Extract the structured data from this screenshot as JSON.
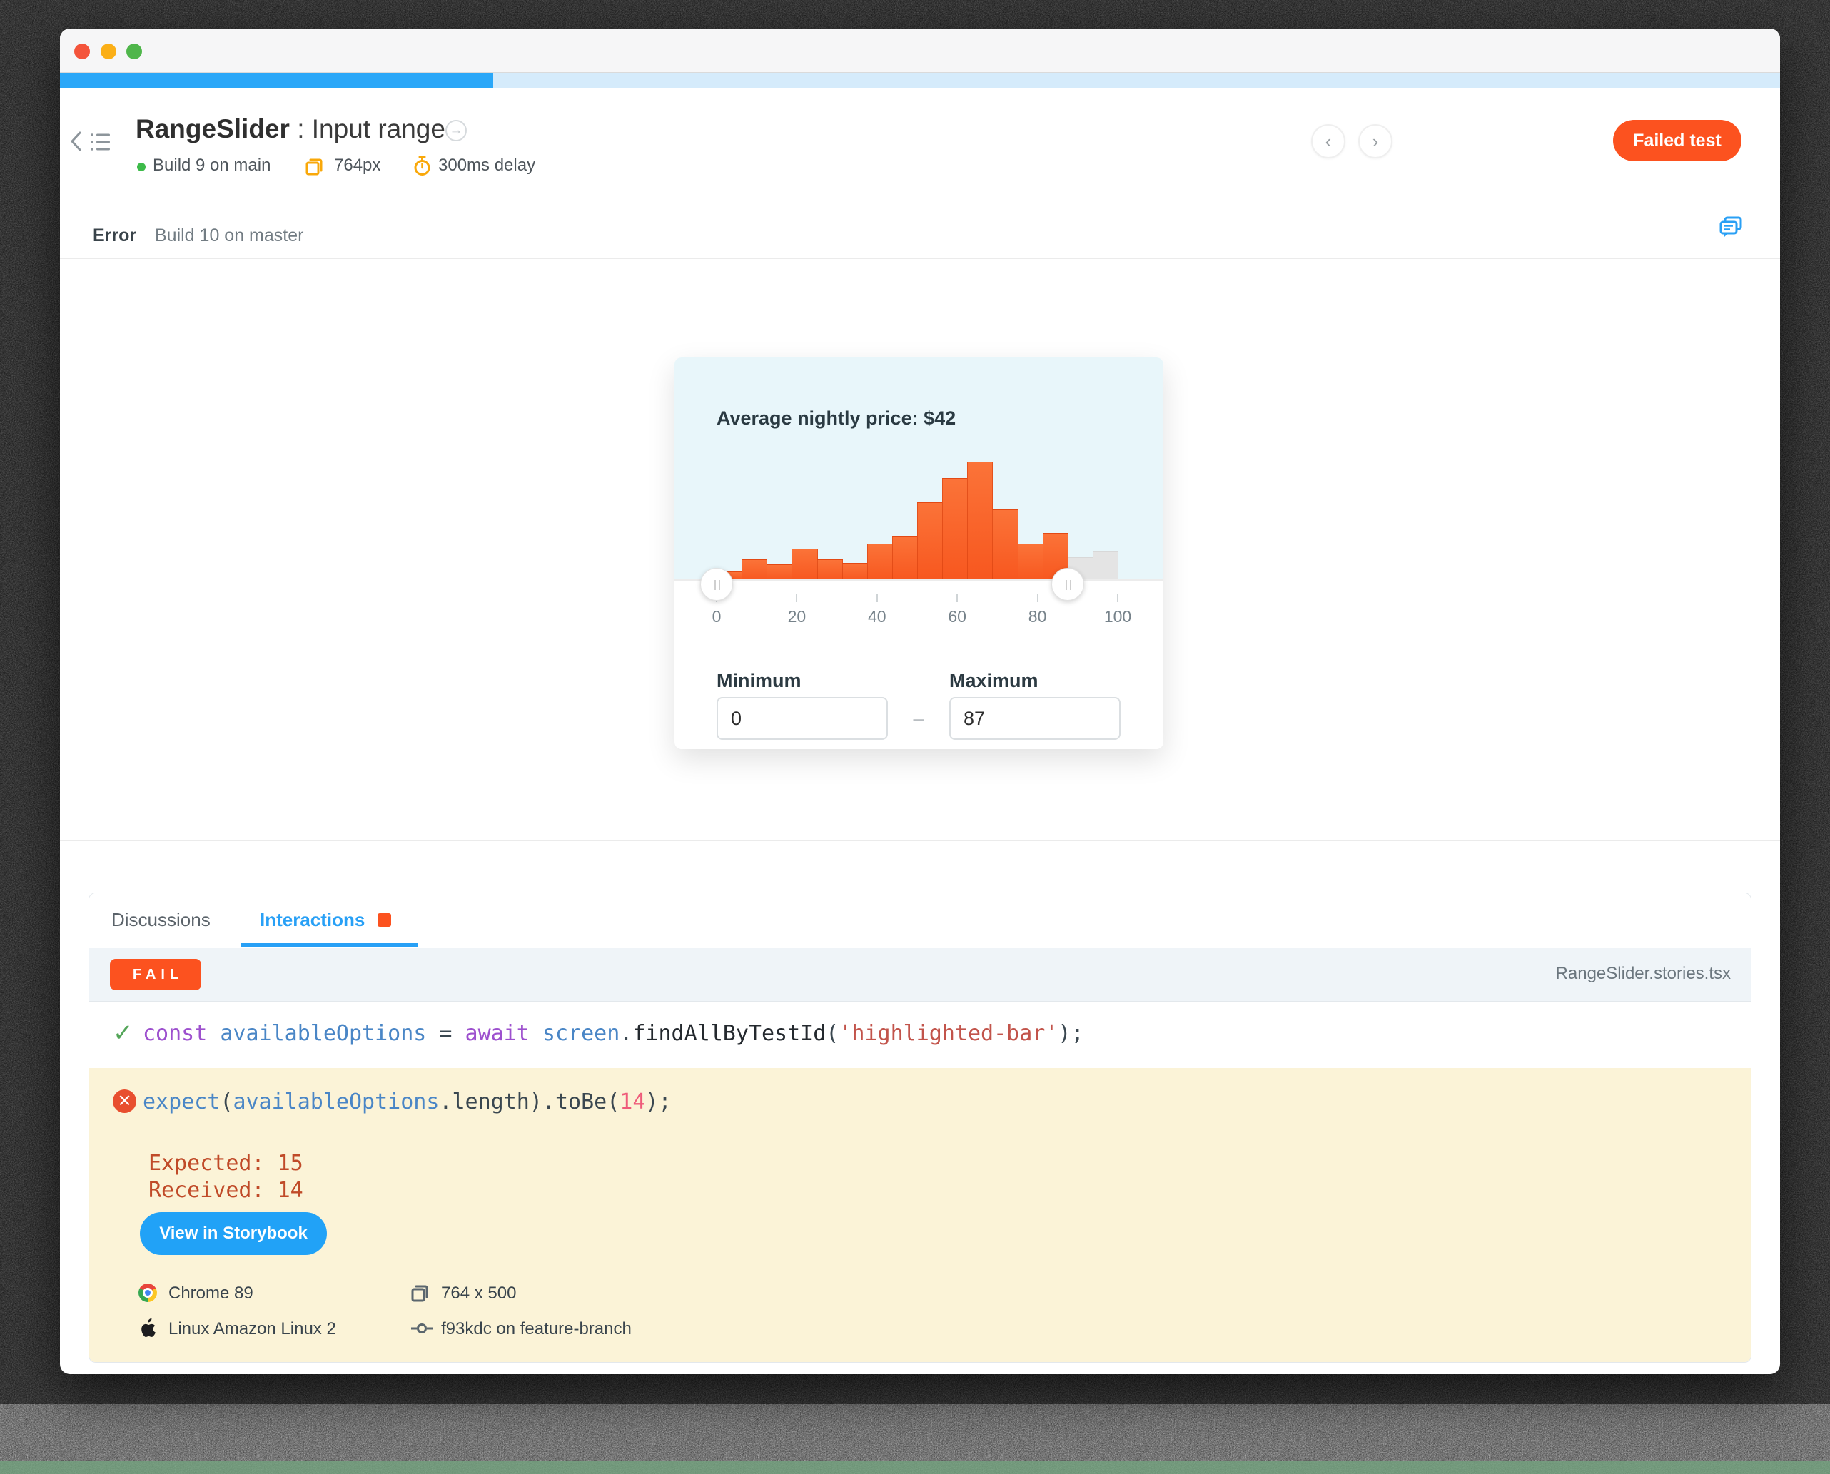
{
  "header": {
    "title_component": "RangeSlider",
    "title_separator": ":",
    "title_story": "Input range",
    "build_badge": "Build 9 on main",
    "viewport": "764px",
    "delay": "300ms delay",
    "failed_button": "Failed test",
    "nav_prev": "‹",
    "nav_next": "›"
  },
  "status_row": {
    "status": "Error",
    "build": "Build 10 on master"
  },
  "progress": {
    "done_pct": 25.2
  },
  "chart_data": {
    "type": "histogram",
    "title": "Average nightly price: $42",
    "xlim": [
      0,
      100
    ],
    "bin_width": 6.25,
    "values": [
      8,
      18,
      14,
      27,
      18,
      15,
      31,
      38,
      66,
      86,
      100,
      60,
      31,
      40,
      20,
      25
    ],
    "highlighted_count": 14,
    "tick_labels": [
      "0",
      "20",
      "40",
      "60",
      "80",
      "100"
    ],
    "slider": {
      "min": 0,
      "max": 87
    },
    "colors": {
      "highlighted": "#F7581F",
      "muted": "#E4E4E4"
    },
    "legend": "none",
    "grid": false
  },
  "range_form": {
    "min_label": "Minimum",
    "max_label": "Maximum",
    "min_value": "0",
    "max_value": "87",
    "separator": "–"
  },
  "interactions": {
    "tabs": [
      {
        "label": "Discussions"
      },
      {
        "label": "Interactions"
      }
    ],
    "fail_badge": "FAIL",
    "file_name": "RangeSlider.stories.tsx",
    "steps": [
      {
        "status": "pass",
        "tokens": [
          {
            "t": "const",
            "c": "kw"
          },
          {
            "t": " ",
            "c": "pl"
          },
          {
            "t": "availableOptions",
            "c": "id"
          },
          {
            "t": " = ",
            "c": "pl"
          },
          {
            "t": "await",
            "c": "kw"
          },
          {
            "t": " ",
            "c": "pl"
          },
          {
            "t": "screen",
            "c": "id"
          },
          {
            "t": ".",
            "c": "pl"
          },
          {
            "t": "findAllByTestId",
            "c": "fn"
          },
          {
            "t": "(",
            "c": "pl"
          },
          {
            "t": "'highlighted-bar'",
            "c": "str"
          },
          {
            "t": ");",
            "c": "pl"
          }
        ]
      },
      {
        "status": "fail",
        "tokens": [
          {
            "t": "expect",
            "c": "id"
          },
          {
            "t": "(",
            "c": "pl"
          },
          {
            "t": "availableOptions",
            "c": "id"
          },
          {
            "t": ".length).toBe(",
            "c": "pl"
          },
          {
            "t": "14",
            "c": "num"
          },
          {
            "t": ");",
            "c": "pl"
          }
        ],
        "expected_line": "Expected: 15",
        "received_line": "Received: 14"
      }
    ],
    "storybook_button": "View in Storybook",
    "env": {
      "browser": "Chrome 89",
      "os": "Linux Amazon Linux 2",
      "viewport": "764 x 500",
      "commit": "f93kdc on feature-branch"
    }
  }
}
